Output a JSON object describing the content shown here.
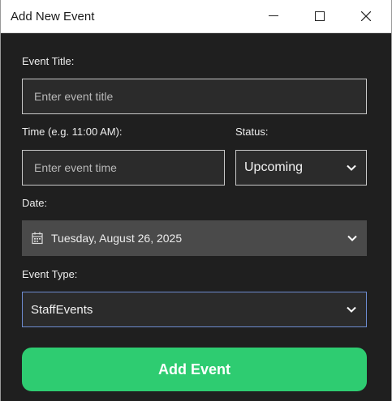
{
  "window": {
    "title": "Add New Event"
  },
  "form": {
    "event_title_label": "Event Title:",
    "event_title_placeholder": "Enter event title",
    "time_label": "Time (e.g. 11:00 AM):",
    "time_placeholder": "Enter event time",
    "status_label": "Status:",
    "status_value": "Upcoming",
    "date_label": "Date:",
    "date_value": "Tuesday, August 26, 2025",
    "event_type_label": "Event Type:",
    "event_type_value": "StaffEvents",
    "submit_label": "Add Event"
  },
  "icons": {
    "minimize": "minimize-icon",
    "maximize": "maximize-icon",
    "close": "close-icon",
    "calendar": "calendar-icon",
    "chevron": "chevron-down-icon"
  },
  "colors": {
    "background": "#1f1f1f",
    "input_bg": "#2b2b2b",
    "date_bg": "#4a4a4a",
    "focus_border": "#6d8bd0",
    "button": "#2ecc71"
  }
}
